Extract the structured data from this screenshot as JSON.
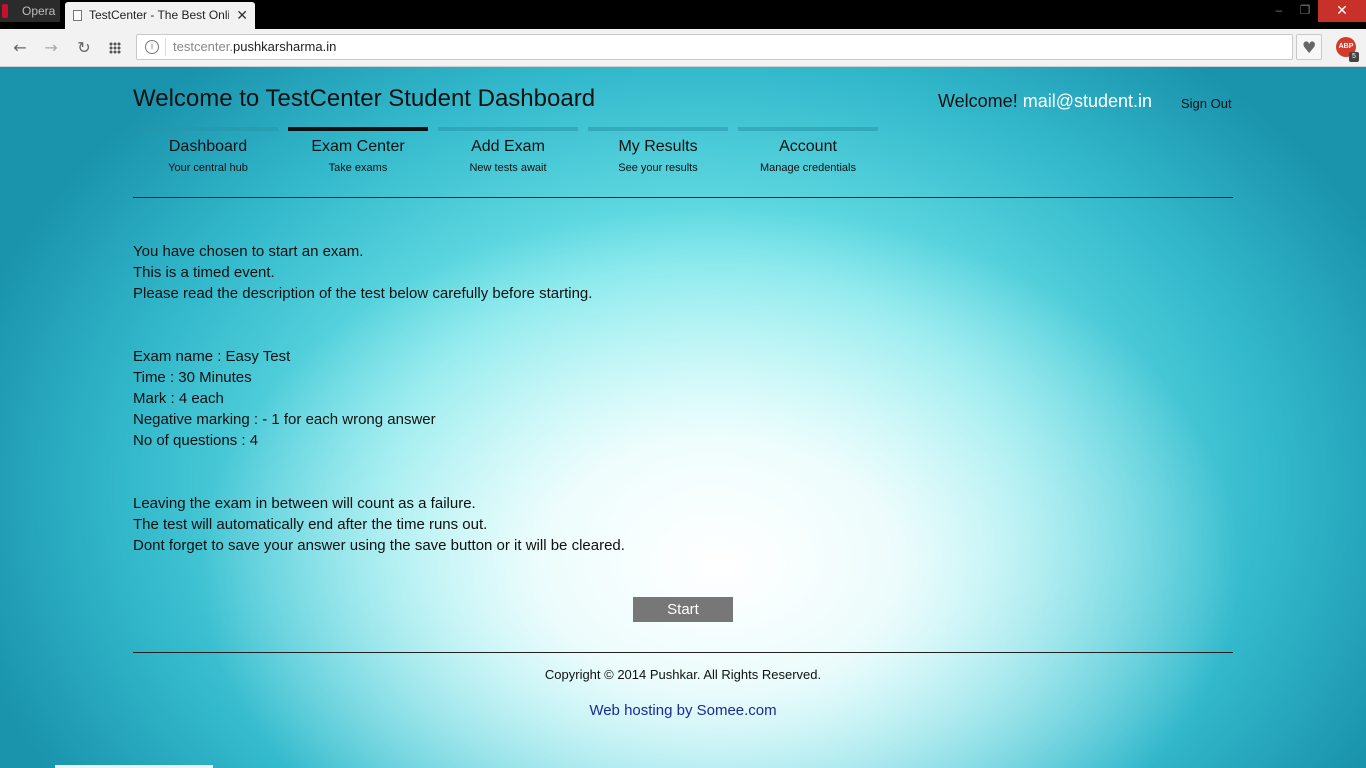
{
  "browser": {
    "app_name": "Opera",
    "tab_title": "TestCenter - The Best Onli",
    "url_prefix": "testcenter.",
    "url_domain": "pushkarsharma.in",
    "abp_label": "ABP",
    "abp_count": "5"
  },
  "header": {
    "title": "Welcome to TestCenter Student Dashboard",
    "welcome_label": "Welcome!",
    "user_email": "mail@student.in",
    "sign_out": "Sign Out"
  },
  "menu": {
    "items": [
      {
        "label": "Dashboard",
        "sub": "Your central hub"
      },
      {
        "label": "Exam Center",
        "sub": "Take exams"
      },
      {
        "label": "Add Exam",
        "sub": "New tests await"
      },
      {
        "label": "My Results",
        "sub": "See your results"
      },
      {
        "label": "Account",
        "sub": "Manage credentials"
      }
    ],
    "active_index": 1
  },
  "intro": [
    "You have chosen to start an exam.",
    "This is a timed event.",
    "Please read the description of the test below carefully before starting."
  ],
  "exam_details": [
    "Exam name : Easy Test",
    "Time : 30 Minutes",
    "Mark : 4 each",
    "Negative marking : - 1 for each wrong answer",
    "No of questions : 4"
  ],
  "rules": [
    "Leaving the exam in between will count as a failure.",
    "The test will automatically end after the time runs out.",
    "Dont forget to save your answer using the save button or it will be cleared."
  ],
  "start_button": "Start",
  "footer": {
    "copyright": "Copyright © 2014 Pushkar. All Rights Reserved.",
    "hosting": "Web hosting by Somee.com"
  },
  "colors": {
    "accent_email": "#ffffff",
    "link": "#1a2a9a",
    "button": "#777777",
    "close_button": "#c8312a"
  }
}
